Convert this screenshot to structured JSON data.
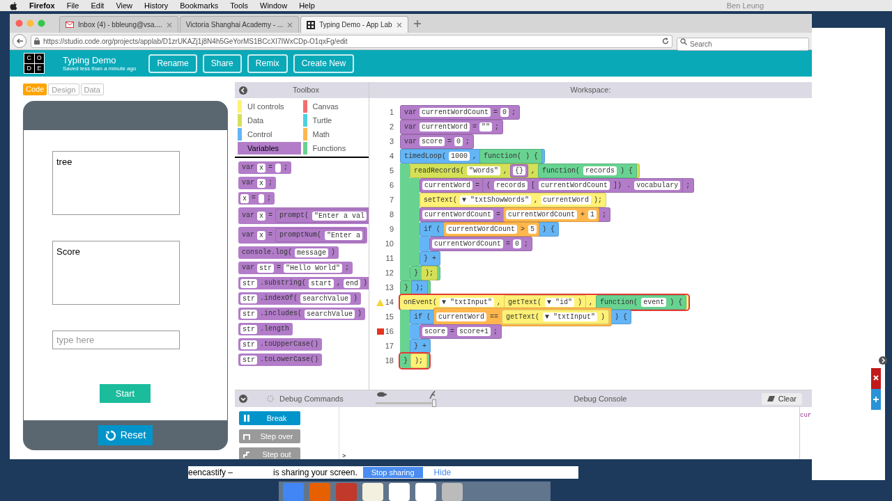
{
  "menu_bar": {
    "app": "Firefox",
    "items": [
      "File",
      "Edit",
      "View",
      "History",
      "Bookmarks",
      "Tools",
      "Window",
      "Help"
    ],
    "user": "Ben Leung"
  },
  "browser": {
    "tabs": [
      {
        "label": "Inbox (4) - bbleung@vsa....",
        "selected": false
      },
      {
        "label": "Victoria Shanghai Academy - ...",
        "selected": false
      },
      {
        "label": "Typing Demo - App Lab",
        "selected": true
      }
    ],
    "url": "https://studio.code.org/projects/applab/D1zrUKAZj1j8N4h5GeYorMS1BCcXI7IWxCDp-O1qxFg/edit",
    "search": {
      "placeholder": "Search"
    }
  },
  "header": {
    "logo": [
      "C",
      "O",
      "D",
      "E"
    ],
    "title": "Typing Demo",
    "subtitle": "Saved less than a minute ago",
    "buttons": [
      "Rename",
      "Share",
      "Remix",
      "Create New"
    ]
  },
  "mode_tabs": [
    {
      "label": "Code",
      "selected": true
    },
    {
      "label": "Design",
      "selected": false
    },
    {
      "label": "Data",
      "selected": false
    }
  ],
  "app_screen": {
    "boxes": [
      "tree",
      "Score"
    ],
    "input": {
      "placeholder": "type here"
    },
    "start_button": "Start",
    "reset_button": "Reset"
  },
  "toolbox": {
    "title": "Toolbox",
    "categories": [
      {
        "label": "UI controls",
        "color": "#fff176",
        "selected": false
      },
      {
        "label": "Canvas",
        "color": "#f36f6f",
        "selected": false
      },
      {
        "label": "Data",
        "color": "#d4e157",
        "selected": false
      },
      {
        "label": "Turtle",
        "color": "#4dd0e1",
        "selected": false
      },
      {
        "label": "Control",
        "color": "#64b5f6",
        "selected": false
      },
      {
        "label": "Math",
        "color": "#ffb74d",
        "selected": false
      },
      {
        "label": "Variables",
        "color": "#b27cc9",
        "selected": true
      },
      {
        "label": "Functions",
        "color": "#68d391",
        "selected": false
      }
    ],
    "blocks": [
      [
        {
          "kind": "text",
          "text": "var"
        },
        {
          "kind": "slot",
          "text": "x"
        },
        {
          "kind": "text",
          "text": "="
        },
        {
          "kind": "empty"
        },
        {
          "kind": "text",
          "text": ";"
        }
      ],
      [
        {
          "kind": "text",
          "text": "var"
        },
        {
          "kind": "slot",
          "text": "x"
        },
        {
          "kind": "text",
          "text": ";"
        }
      ],
      [
        {
          "kind": "slot",
          "text": "x"
        },
        {
          "kind": "text",
          "text": "="
        },
        {
          "kind": "empty"
        },
        {
          "kind": "text",
          "text": ";"
        }
      ],
      [
        {
          "kind": "text",
          "text": "var"
        },
        {
          "kind": "slot",
          "text": "x"
        },
        {
          "kind": "text",
          "text": "="
        },
        {
          "kind": "group",
          "color": "#b27cc9",
          "tokens": [
            {
              "kind": "text",
              "text": "prompt("
            },
            {
              "kind": "slot",
              "text": "\"Enter a val"
            }
          ]
        }
      ],
      [
        {
          "kind": "text",
          "text": "var"
        },
        {
          "kind": "slot",
          "text": "x"
        },
        {
          "kind": "text",
          "text": "="
        },
        {
          "kind": "group",
          "color": "#b27cc9",
          "tokens": [
            {
              "kind": "text",
              "text": "promptNum("
            },
            {
              "kind": "slot",
              "text": "\"Enter a"
            }
          ]
        }
      ],
      [
        {
          "kind": "text",
          "text": "console.log("
        },
        {
          "kind": "slot",
          "text": "message"
        },
        {
          "kind": "text",
          "text": ")"
        }
      ],
      [
        {
          "kind": "text",
          "text": "var"
        },
        {
          "kind": "slot",
          "text": "str"
        },
        {
          "kind": "text",
          "text": "="
        },
        {
          "kind": "slot",
          "text": "\"Hello World\""
        },
        {
          "kind": "text",
          "text": ";"
        }
      ],
      [
        {
          "kind": "slot",
          "text": "str"
        },
        {
          "kind": "text",
          "text": ".substring("
        },
        {
          "kind": "slot",
          "text": "start"
        },
        {
          "kind": "text",
          "text": ","
        },
        {
          "kind": "slot",
          "text": "end"
        },
        {
          "kind": "text",
          "text": ")"
        }
      ],
      [
        {
          "kind": "slot",
          "text": "str"
        },
        {
          "kind": "text",
          "text": ".indexOf("
        },
        {
          "kind": "slot",
          "text": "searchValue"
        },
        {
          "kind": "text",
          "text": ")"
        }
      ],
      [
        {
          "kind": "slot",
          "text": "str"
        },
        {
          "kind": "text",
          "text": ".includes("
        },
        {
          "kind": "slot",
          "text": "searchValue"
        },
        {
          "kind": "text",
          "text": ")"
        }
      ],
      [
        {
          "kind": "slot",
          "text": "str"
        },
        {
          "kind": "text",
          "text": ".length"
        }
      ],
      [
        {
          "kind": "slot",
          "text": "str"
        },
        {
          "kind": "text",
          "text": ".toUpperCase()"
        }
      ],
      [
        {
          "kind": "slot",
          "text": "str"
        },
        {
          "kind": "text",
          "text": ".toLowerCase()"
        }
      ]
    ]
  },
  "workspace": {
    "title": "Workspace:",
    "code": [
      {
        "n": "1",
        "color": "#b27cc9",
        "tokens": [
          {
            "kind": "text",
            "text": "var"
          },
          {
            "kind": "slot",
            "text": "currentWordCount"
          },
          {
            "kind": "text",
            "text": "="
          },
          {
            "kind": "slot",
            "text": "0"
          },
          {
            "kind": "text",
            "text": ";"
          }
        ]
      },
      {
        "n": "2",
        "color": "#b27cc9",
        "tokens": [
          {
            "kind": "text",
            "text": "var"
          },
          {
            "kind": "slot",
            "text": "currentWord"
          },
          {
            "kind": "text",
            "text": "="
          },
          {
            "kind": "slot",
            "text": "\"\""
          },
          {
            "kind": "text",
            "text": ";"
          }
        ]
      },
      {
        "n": "3",
        "color": "#b27cc9",
        "tokens": [
          {
            "kind": "text",
            "text": "var"
          },
          {
            "kind": "slot",
            "text": "score"
          },
          {
            "kind": "text",
            "text": "="
          },
          {
            "kind": "slot",
            "text": "0"
          },
          {
            "kind": "text",
            "text": ";"
          }
        ]
      },
      {
        "n": "4",
        "color": "#64b5f6",
        "body": {
          "color": "#68d391"
        },
        "tokens": [
          {
            "kind": "text",
            "text": "timedLoop("
          },
          {
            "kind": "slot",
            "text": "1000"
          },
          {
            "kind": "text",
            "text": ","
          },
          {
            "kind": "group",
            "color": "#68d391",
            "tokens": [
              {
                "kind": "text",
                "text": "function( ) {"
              }
            ]
          }
        ],
        "children": [
          {
            "n": "5",
            "color": "#d4e157",
            "body": {
              "color": "#68d391"
            },
            "tokens": [
              {
                "kind": "text",
                "text": "readRecords("
              },
              {
                "kind": "slot",
                "text": "\"Words\""
              },
              {
                "kind": "text",
                "text": ","
              },
              {
                "kind": "group",
                "color": "#b27cc9",
                "tokens": [
                  {
                    "kind": "slot",
                    "text": "{}"
                  }
                ]
              },
              {
                "kind": "text",
                "text": ","
              },
              {
                "kind": "group",
                "color": "#68d391",
                "tokens": [
                  {
                    "kind": "text",
                    "text": "function("
                  },
                  {
                    "kind": "slot",
                    "text": "records"
                  },
                  {
                    "kind": "text",
                    "text": ") {"
                  }
                ]
              }
            ],
            "children": [
              {
                "n": "6",
                "color": "#b27cc9",
                "tokens": [
                  {
                    "kind": "slot",
                    "text": "currentWord"
                  },
                  {
                    "kind": "text",
                    "text": "="
                  },
                  {
                    "kind": "group",
                    "color": "#b27cc9",
                    "tokens": [
                      {
                        "kind": "text",
                        "text": "("
                      },
                      {
                        "kind": "slot",
                        "text": "records"
                      },
                      {
                        "kind": "text",
                        "text": "["
                      },
                      {
                        "kind": "slot",
                        "text": "currentWordCount"
                      },
                      {
                        "kind": "text",
                        "text": "])"
                      },
                      {
                        "kind": "text",
                        "text": "."
                      },
                      {
                        "kind": "slot",
                        "text": "vocabulary"
                      }
                    ]
                  },
                  {
                    "kind": "text",
                    "text": ";"
                  }
                ]
              },
              {
                "n": "7",
                "color": "#fff176",
                "tokens": [
                  {
                    "kind": "text",
                    "text": "setText("
                  },
                  {
                    "kind": "slot",
                    "text": "▼ \"txtShowWords\""
                  },
                  {
                    "kind": "text",
                    "text": ","
                  },
                  {
                    "kind": "slot",
                    "text": "currentWord"
                  },
                  {
                    "kind": "text",
                    "text": ");"
                  }
                ]
              },
              {
                "n": "8",
                "color": "#b27cc9",
                "tokens": [
                  {
                    "kind": "slot",
                    "text": "currentWordCount"
                  },
                  {
                    "kind": "text",
                    "text": "="
                  },
                  {
                    "kind": "group",
                    "color": "#ffb74d",
                    "tokens": [
                      {
                        "kind": "slot",
                        "text": "currentWordCount"
                      },
                      {
                        "kind": "text",
                        "text": "+"
                      },
                      {
                        "kind": "slot",
                        "text": "1"
                      }
                    ]
                  },
                  {
                    "kind": "text",
                    "text": ";"
                  }
                ]
              },
              {
                "n": "9",
                "color": "#64b5f6",
                "body": {
                  "color": "#64b5f6"
                },
                "tokens": [
                  {
                    "kind": "text",
                    "text": "if ("
                  },
                  {
                    "kind": "group",
                    "color": "#ffb74d",
                    "tokens": [
                      {
                        "kind": "slot",
                        "text": "currentWordCount"
                      },
                      {
                        "kind": "text",
                        "text": ">"
                      },
                      {
                        "kind": "slot",
                        "text": "5"
                      }
                    ]
                  },
                  {
                    "kind": "text",
                    "text": ") {"
                  }
                ],
                "children": [
                  {
                    "n": "10",
                    "color": "#b27cc9",
                    "tokens": [
                      {
                        "kind": "slot",
                        "text": "currentWordCount"
                      },
                      {
                        "kind": "text",
                        "text": "="
                      },
                      {
                        "kind": "slot",
                        "text": "0"
                      },
                      {
                        "kind": "text",
                        "text": ";"
                      }
                    ]
                  }
                ],
                "close": {
                  "n": "11",
                  "color": "#64b5f6",
                  "tokens": [
                    {
                      "kind": "text",
                      "text": "}"
                    },
                    {
                      "kind": "text",
                      "text": "+"
                    }
                  ]
                }
              }
            ],
            "close": {
              "n": "12",
              "color": "#68d391",
              "tokens": [
                {
                  "kind": "text",
                  "text": "}"
                },
                {
                  "kind": "group",
                  "color": "#d4e157",
                  "tokens": [
                    {
                      "kind": "text",
                      "text": ");"
                    }
                  ]
                }
              ]
            }
          }
        ],
        "close": {
          "n": "13",
          "color": "#68d391",
          "tokens": [
            {
              "kind": "text",
              "text": "}"
            },
            {
              "kind": "group",
              "color": "#64b5f6",
              "tokens": [
                {
                  "kind": "text",
                  "text": ");"
                }
              ]
            }
          ]
        }
      },
      {
        "n": "14",
        "color": "#fff176",
        "body": {
          "color": "#68d391"
        },
        "warning": true,
        "selected": true,
        "tokens": [
          {
            "kind": "text",
            "text": "onEvent("
          },
          {
            "kind": "slot",
            "text": "▼ \"txtInput\""
          },
          {
            "kind": "text",
            "text": ","
          },
          {
            "kind": "group",
            "color": "#fff176",
            "tokens": [
              {
                "kind": "text",
                "text": "getText("
              },
              {
                "kind": "slot",
                "text": "▼ \"id\""
              },
              {
                "kind": "text",
                "text": ")"
              }
            ]
          },
          {
            "kind": "text",
            "text": ","
          },
          {
            "kind": "group",
            "color": "#68d391",
            "tokens": [
              {
                "kind": "text",
                "text": "function("
              },
              {
                "kind": "slot",
                "text": "event"
              },
              {
                "kind": "text",
                "text": ") {"
              }
            ]
          }
        ],
        "children": [
          {
            "n": "15",
            "color": "#64b5f6",
            "body": {
              "color": "#64b5f6"
            },
            "tokens": [
              {
                "kind": "text",
                "text": "if ("
              },
              {
                "kind": "group",
                "color": "#ffb74d",
                "tokens": [
                  {
                    "kind": "slot",
                    "text": "currentWord"
                  },
                  {
                    "kind": "text",
                    "text": "=="
                  },
                  {
                    "kind": "group",
                    "color": "#fff176",
                    "tokens": [
                      {
                        "kind": "text",
                        "text": "getText("
                      },
                      {
                        "kind": "slot",
                        "text": "▼ \"txtInput\""
                      },
                      {
                        "kind": "text",
                        "text": ")"
                      }
                    ]
                  }
                ]
              },
              {
                "kind": "text",
                "text": ") {"
              }
            ],
            "children": [
              {
                "n": "16",
                "color": "#b27cc9",
                "breakpoint": true,
                "tokens": [
                  {
                    "kind": "slot",
                    "text": "score"
                  },
                  {
                    "kind": "text",
                    "text": "="
                  },
                  {
                    "kind": "slot",
                    "text": "score+1"
                  },
                  {
                    "kind": "text",
                    "text": ";"
                  }
                ]
              }
            ],
            "close": {
              "n": "17",
              "color": "#64b5f6",
              "tokens": [
                {
                  "kind": "text",
                  "text": "}"
                },
                {
                  "kind": "text",
                  "text": "+"
                }
              ]
            }
          }
        ],
        "close": {
          "n": "18",
          "color": "#68d391",
          "tokens": [
            {
              "kind": "text",
              "text": "}"
            },
            {
              "kind": "group",
              "color": "#fff176",
              "tokens": [
                {
                  "kind": "text",
                  "text": ");"
                }
              ]
            }
          ]
        }
      }
    ]
  },
  "debug": {
    "commands_title": "Debug Commands",
    "console_title": "Debug Console",
    "speed": {
      "level": 1
    },
    "clear_button": "Clear",
    "buttons": [
      {
        "label": "Break",
        "kind": "pause",
        "disabled": false
      },
      {
        "label": "Step over",
        "kind": "over",
        "disabled": true
      },
      {
        "label": "Step out",
        "kind": "out",
        "disabled": true
      }
    ],
    "prompt": ">",
    "watch_text": "cur"
  },
  "share_bar": {
    "fragment": "eencastify –",
    "message": "is sharing your screen.",
    "stop_button": "Stop sharing",
    "hide_link": "Hide"
  }
}
